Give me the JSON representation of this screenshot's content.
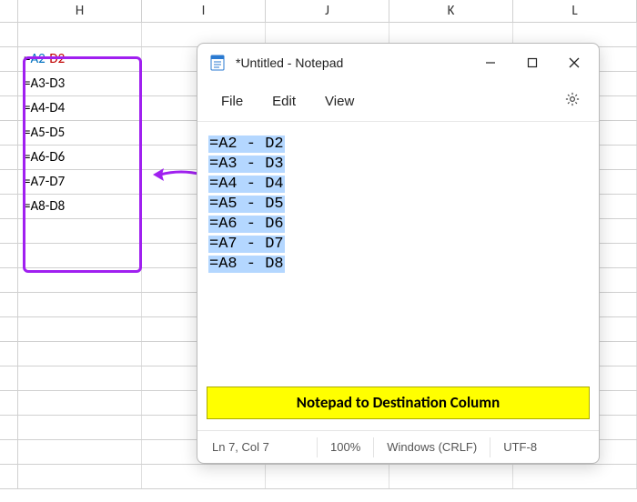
{
  "spreadsheet": {
    "columns": [
      "H",
      "I",
      "J",
      "K",
      "L"
    ],
    "formulas": [
      "=A2-D2",
      "=A3-D3",
      "=A4-D4",
      "=A5-D5",
      "=A6-D6",
      "=A7-D7",
      "=A8-D8"
    ],
    "first_formula_parts": {
      "eq": "=",
      "ref1": "A2",
      "dash": "-",
      "ref2": "D2"
    }
  },
  "notepad": {
    "title": "*Untitled - Notepad",
    "menu": {
      "file": "File",
      "edit": "Edit",
      "view": "View"
    },
    "content_lines": [
      "=A2-D2",
      "=A3-D3",
      "=A4-D4",
      "=A5-D5",
      "=A6-D6",
      "=A7-D7",
      "=A8-D8"
    ],
    "annotation": "Notepad to Destination Column",
    "status": {
      "position": "Ln 7, Col 7",
      "zoom": "100%",
      "eol": "Windows (CRLF)",
      "encoding": "UTF-8"
    }
  }
}
